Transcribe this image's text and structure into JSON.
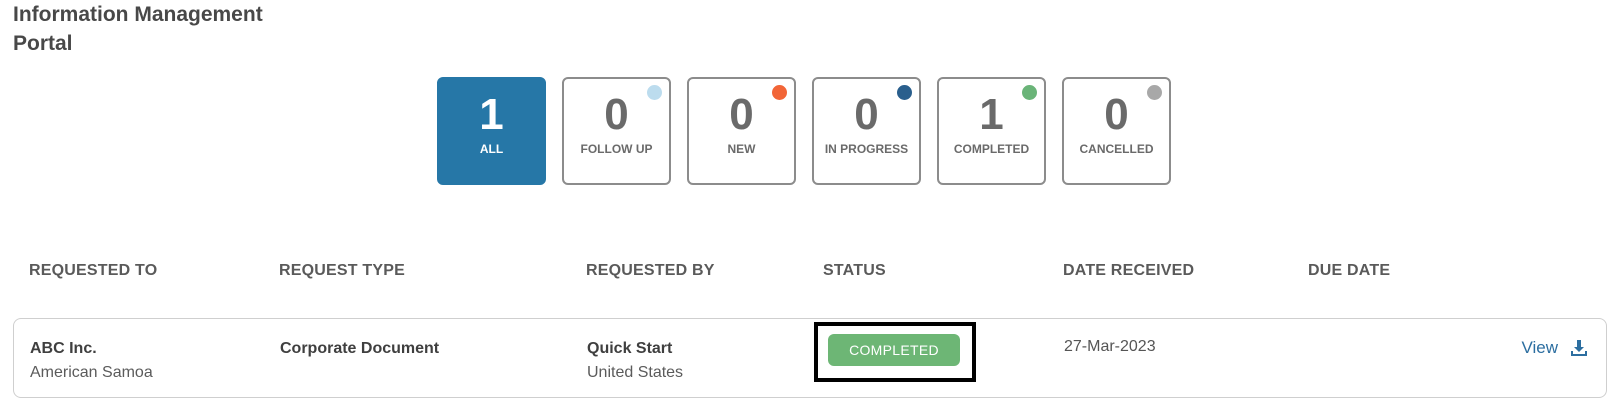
{
  "page": {
    "title": "Information Management Portal"
  },
  "filters": [
    {
      "count": "1",
      "label": "ALL",
      "dot_color": null,
      "active": true
    },
    {
      "count": "0",
      "label": "FOLLOW UP",
      "dot_color": "#bcdcee",
      "active": false
    },
    {
      "count": "0",
      "label": "NEW",
      "dot_color": "#f26537",
      "active": false
    },
    {
      "count": "0",
      "label": "IN PROGRESS",
      "dot_color": "#2a5f8d",
      "active": false
    },
    {
      "count": "1",
      "label": "COMPLETED",
      "dot_color": "#6ab478",
      "active": false
    },
    {
      "count": "0",
      "label": "CANCELLED",
      "dot_color": "#a8a8a8",
      "active": false
    }
  ],
  "table": {
    "headers": [
      "REQUESTED TO",
      "REQUEST TYPE",
      "REQUESTED BY",
      "STATUS",
      "DATE RECEIVED",
      "DUE DATE"
    ],
    "rows": [
      {
        "requested_to": "ABC Inc.",
        "requested_to_sub": "American Samoa",
        "request_type": "Corporate Document",
        "requested_by": "Quick Start",
        "requested_by_sub": "United States",
        "status": "COMPLETED",
        "date_received": "27-Mar-2023",
        "due_date": "",
        "action_label": "View"
      }
    ]
  },
  "colors": {
    "accent": "#2677a7",
    "status_completed": "#6db675",
    "link": "#2c6ea0"
  },
  "icons": {
    "action_icon": "download-icon"
  }
}
